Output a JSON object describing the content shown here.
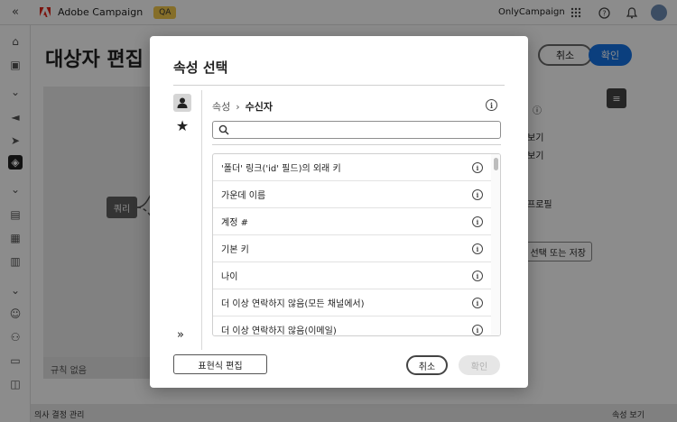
{
  "topbar": {
    "collapse_icon": "double-chevron-left-icon",
    "app_name": "Adobe Campaign",
    "env_badge": "QA",
    "org_name": "OnlyCampaign",
    "icons": [
      "apps-grid-icon",
      "help-icon",
      "bell-icon",
      "avatar"
    ]
  },
  "background": {
    "page_title": "대상자 편집",
    "cancel_label": "취소",
    "ok_label": "확인",
    "query_node_label": "쿼리",
    "rules_bar_text": "규칙 없음",
    "right_panel": {
      "line1": "보기",
      "line2": "보기",
      "line3": "프로필",
      "save_button": "선택 또는 저장"
    },
    "bottom_left": "의사 결정 관리",
    "bottom_right": "속성 보기"
  },
  "modal": {
    "title": "속성 선택",
    "breadcrumb": {
      "root": "속성",
      "separator": "›",
      "current": "수신자"
    },
    "search": {
      "value": "",
      "placeholder": ""
    },
    "items": [
      {
        "label": "'폴더' 링크('id' 필드)의 외래 키"
      },
      {
        "label": "가운데 이름"
      },
      {
        "label": "계정 #"
      },
      {
        "label": "기본 키"
      },
      {
        "label": "나이"
      },
      {
        "label": "더 이상 연락하지 않음(모든 채널에서)"
      },
      {
        "label": "더 이상 연락하지 않음(이메일)"
      }
    ],
    "expression_button": "표현식 편집",
    "cancel_button": "취소",
    "confirm_button": "확인"
  },
  "colors": {
    "accent": "#1473e6",
    "badge": "#f2c94c",
    "overlay": "rgba(0,0,0,0.45)"
  }
}
